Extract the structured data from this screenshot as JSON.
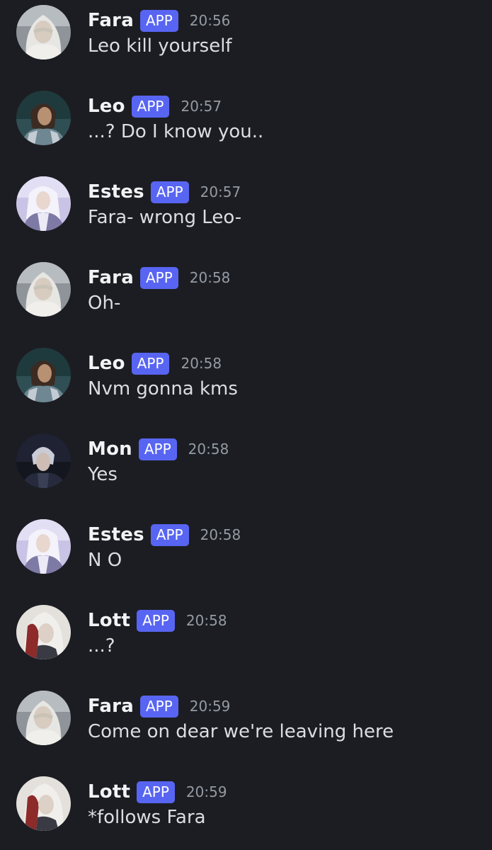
{
  "messages": [
    {
      "author": "Fara",
      "badge": "APP",
      "time": "20:56",
      "text": "Leo kill yourself",
      "avatar": "fara-avatar"
    },
    {
      "author": "Leo",
      "badge": "APP",
      "time": "20:57",
      "text": "...? Do I know you..",
      "avatar": "leo-avatar"
    },
    {
      "author": "Estes",
      "badge": "APP",
      "time": "20:57",
      "text": "Fara- wrong Leo-",
      "avatar": "estes-avatar"
    },
    {
      "author": "Fara",
      "badge": "APP",
      "time": "20:58",
      "text": "Oh-",
      "avatar": "fara-avatar"
    },
    {
      "author": "Leo",
      "badge": "APP",
      "time": "20:58",
      "text": "Nvm gonna kms",
      "avatar": "leo-avatar"
    },
    {
      "author": "Mon",
      "badge": "APP",
      "time": "20:58",
      "text": "Yes",
      "avatar": "mon-avatar"
    },
    {
      "author": "Estes",
      "badge": "APP",
      "time": "20:58",
      "text": "N O",
      "avatar": "estes-avatar"
    },
    {
      "author": "Lott",
      "badge": "APP",
      "time": "20:58",
      "text": "...?",
      "avatar": "lott-avatar"
    },
    {
      "author": "Fara",
      "badge": "APP",
      "time": "20:59",
      "text": "Come on dear we're leaving here",
      "avatar": "fara-avatar"
    },
    {
      "author": "Lott",
      "badge": "APP",
      "time": "20:59",
      "text": "*follows Fara",
      "avatar": "lott-avatar"
    }
  ],
  "colors": {
    "background": "#1c1d22",
    "badge": "#5865f2",
    "username": "#f2f3f5",
    "timestamp": "#949ba4",
    "message_text": "#dbdee1"
  }
}
